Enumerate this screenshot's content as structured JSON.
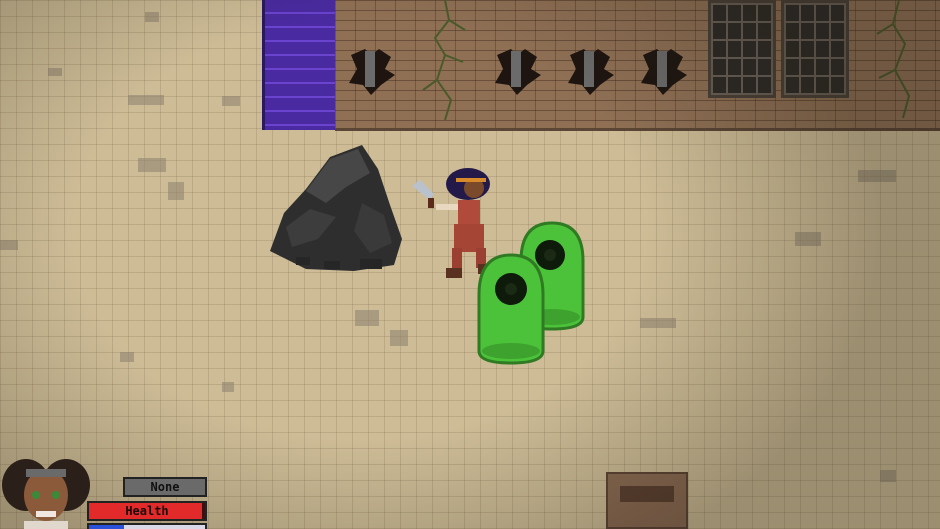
{
  "hud": {
    "equipped_item": "None",
    "health_label": "Health",
    "health_fraction": 0.97,
    "mana_fraction": 0.3
  },
  "colors": {
    "floor": "#cdbc96",
    "wall": "#8f7055",
    "stairs": "#4a2aa0",
    "slime": "#4cc23a",
    "health": "#e22a2a",
    "mana": "#2a4fd8"
  }
}
